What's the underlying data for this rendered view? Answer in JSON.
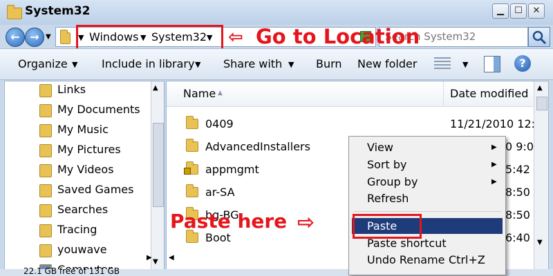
{
  "window": {
    "title": "System32"
  },
  "address": {
    "crumbs": [
      "Windows",
      "System32"
    ]
  },
  "search": {
    "placeholder": "Search System32"
  },
  "toolbar": {
    "organize": "Organize",
    "include_in_library": "Include in library",
    "share_with": "Share with",
    "burn": "Burn",
    "new_folder": "New folder"
  },
  "nav": {
    "items": [
      {
        "label": "Links",
        "icon": "links-folder-icon"
      },
      {
        "label": "My Documents",
        "icon": "documents-folder-icon"
      },
      {
        "label": "My Music",
        "icon": "music-folder-icon"
      },
      {
        "label": "My Pictures",
        "icon": "pictures-folder-icon"
      },
      {
        "label": "My Videos",
        "icon": "videos-folder-icon"
      },
      {
        "label": "Saved Games",
        "icon": "saved-games-folder-icon"
      },
      {
        "label": "Searches",
        "icon": "searches-folder-icon"
      },
      {
        "label": "Tracing",
        "icon": "folder-icon"
      },
      {
        "label": "youwave",
        "icon": "folder-icon"
      },
      {
        "label": "Computer",
        "icon": "computer-icon"
      }
    ]
  },
  "columns": {
    "name": "Name",
    "date_modified": "Date modified"
  },
  "files": [
    {
      "name": "0409",
      "date": "11/21/2010 12:",
      "icon": "folder-icon"
    },
    {
      "name": "AdvancedInstallers",
      "date": "0 9:00",
      "icon": "folder-icon"
    },
    {
      "name": "appmgmt",
      "date": "5:42 P",
      "icon": "locked-folder-icon"
    },
    {
      "name": "ar-SA",
      "date": "8:50",
      "icon": "folder-icon"
    },
    {
      "name": "bg-BG",
      "date": "8:50",
      "icon": "folder-icon"
    },
    {
      "name": "Boot",
      "date": "6:40",
      "icon": "folder-icon"
    }
  ],
  "context_menu": {
    "items": [
      {
        "label": "View",
        "submenu": true
      },
      {
        "label": "Sort by",
        "submenu": true
      },
      {
        "label": "Group by",
        "submenu": true
      },
      {
        "label": "Refresh",
        "submenu": false
      },
      {
        "label": "Paste",
        "submenu": false,
        "highlighted": true
      },
      {
        "label": "Paste shortcut",
        "submenu": false
      },
      {
        "label": "Undo Rename",
        "submenu": false,
        "shortcut": "Ctrl+Z"
      }
    ]
  },
  "status": {
    "text": "22.1 GB free of 131 GB"
  },
  "annotations": {
    "go_to_location": "Go to Location",
    "paste_here": "Paste here",
    "arrow_glyph": "⇦",
    "arrow_right_glyph": "⇨"
  },
  "colors": {
    "annotation_red": "#e5151c",
    "menu_highlight": "#1f3c7a"
  }
}
